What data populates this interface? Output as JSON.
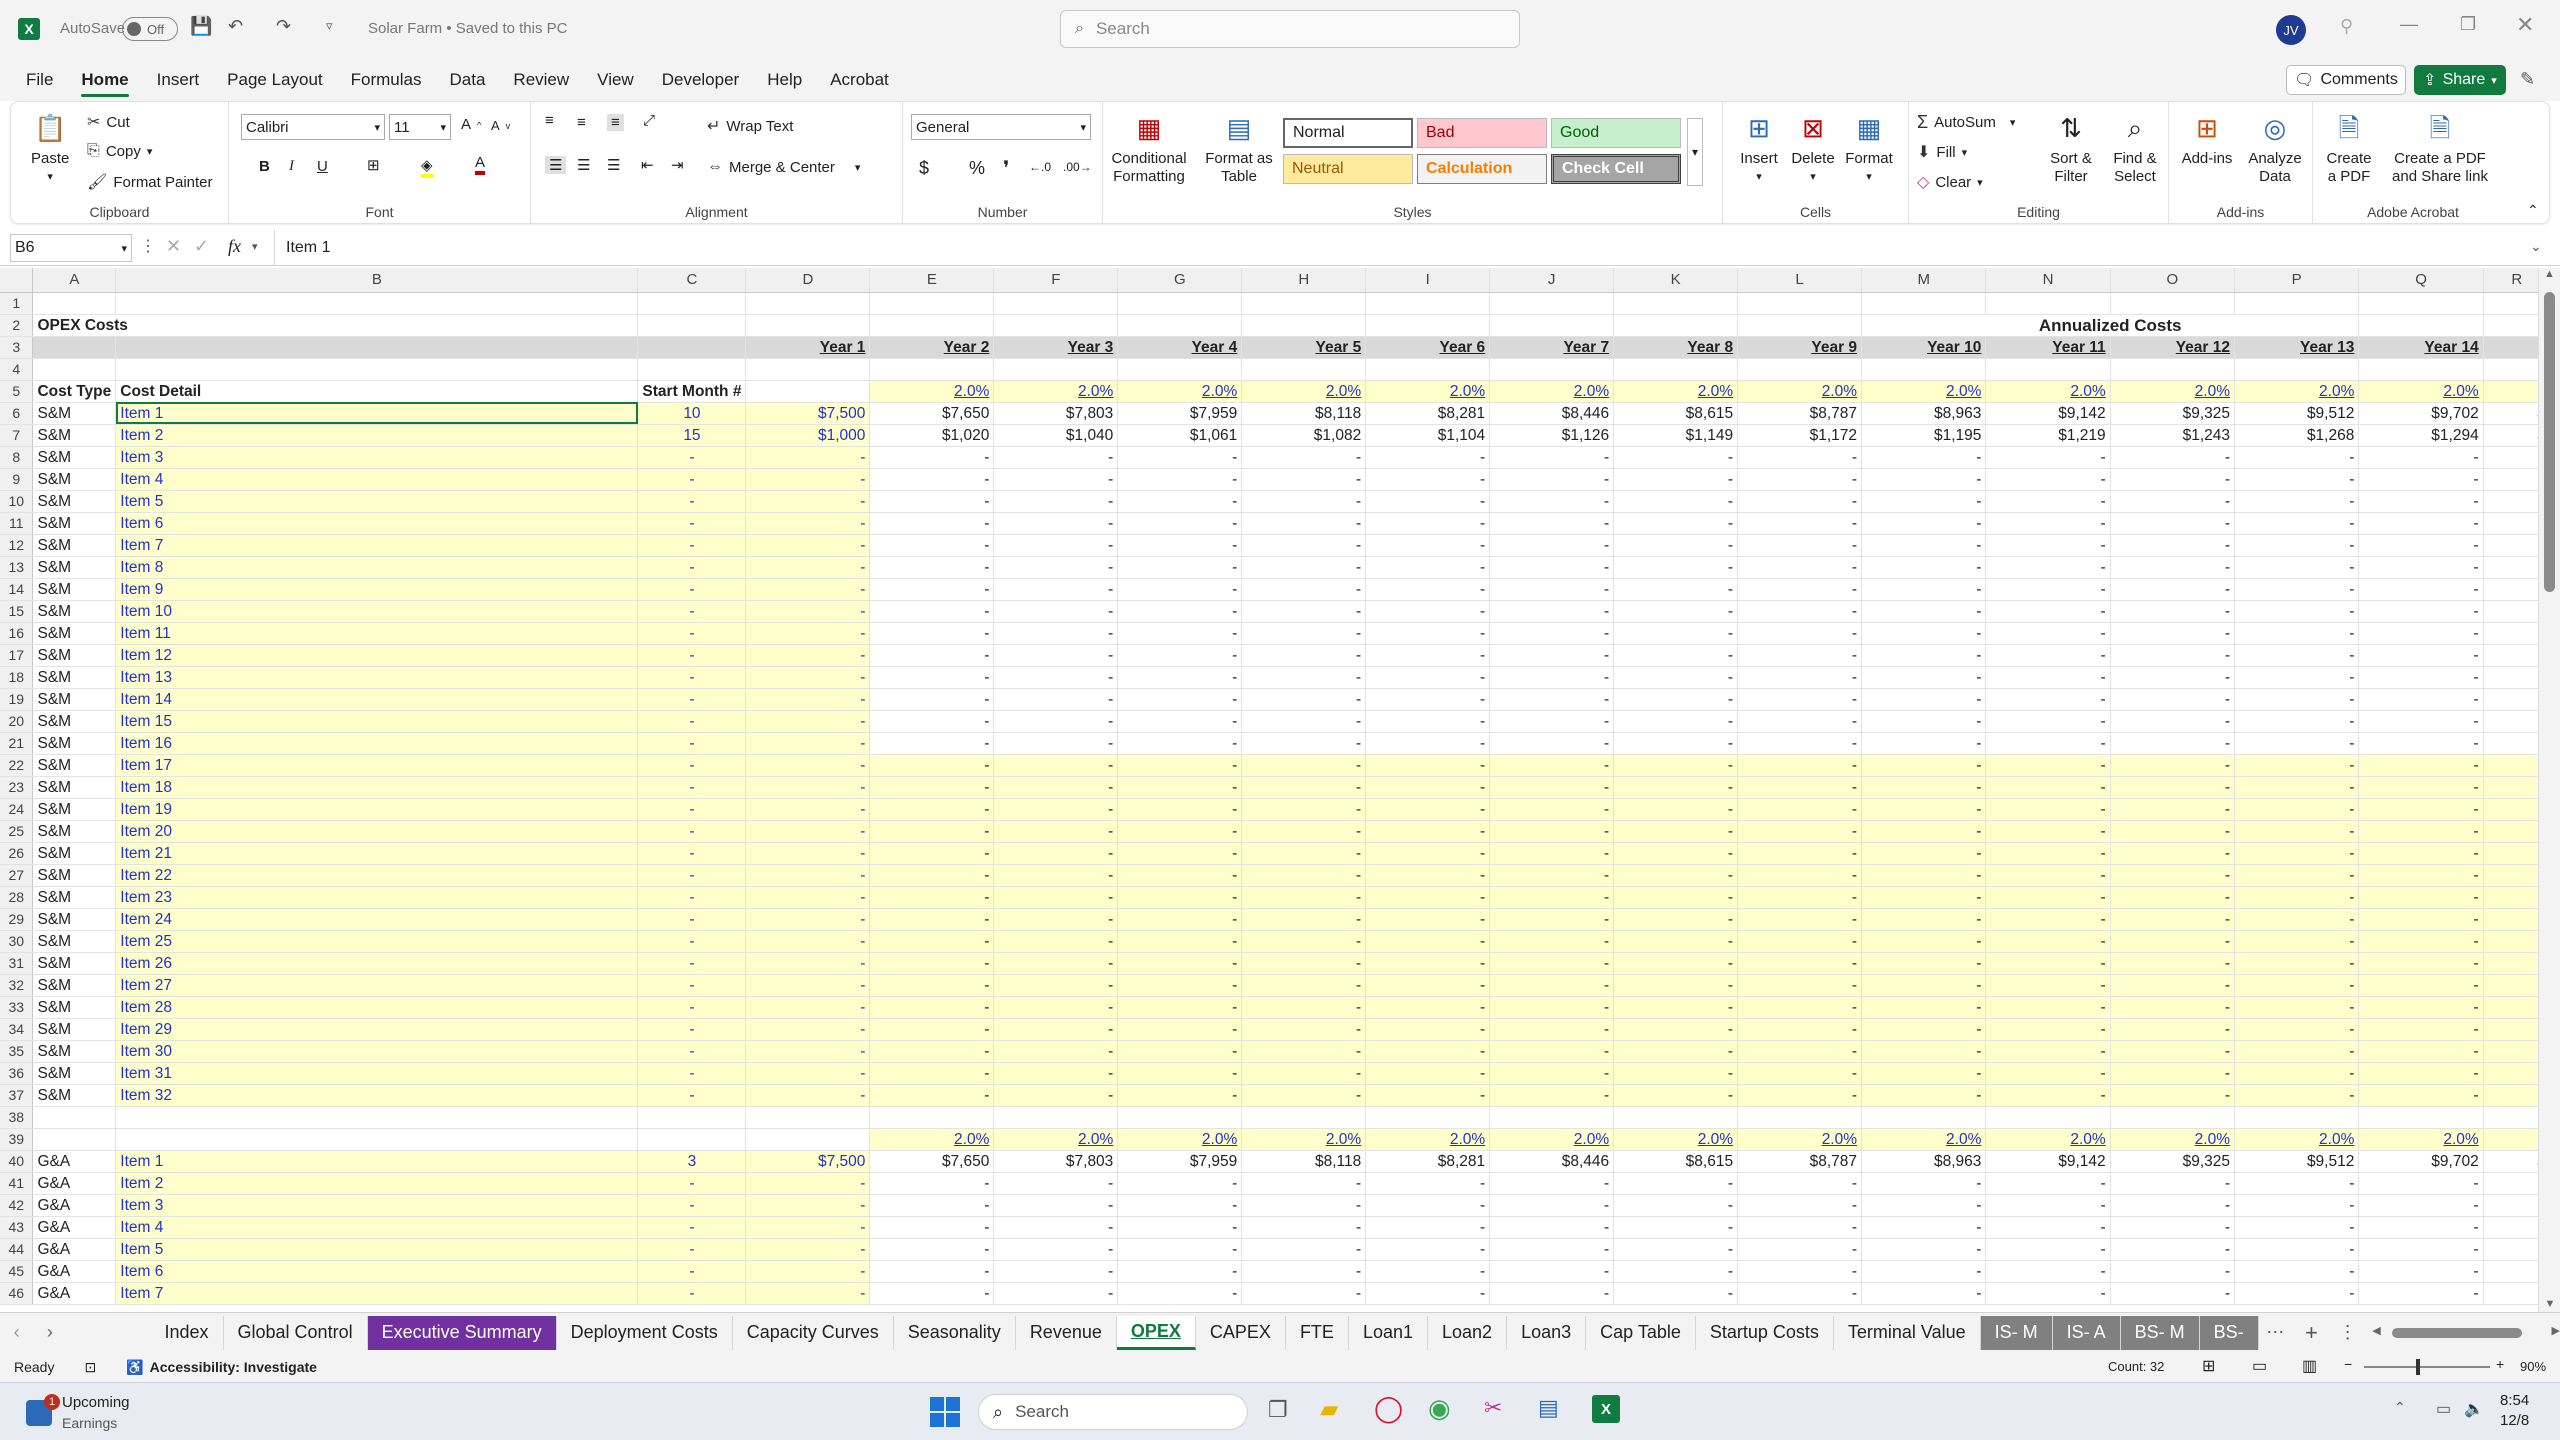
{
  "titlebar": {
    "autosave_label": "AutoSave",
    "autosave_state": "Off",
    "doc_title": "Solar Farm • Saved to this PC",
    "search_placeholder": "Search",
    "user_initials": "JV"
  },
  "ribbon_tabs": [
    "File",
    "Home",
    "Insert",
    "Page Layout",
    "Formulas",
    "Data",
    "Review",
    "View",
    "Developer",
    "Help",
    "Acrobat"
  ],
  "ribbon_right": {
    "comments": "Comments",
    "share": "Share"
  },
  "clipboard": {
    "paste": "Paste",
    "cut": "Cut",
    "copy": "Copy",
    "format_painter": "Format Painter",
    "label": "Clipboard"
  },
  "font": {
    "name": "Calibri",
    "size": "11",
    "label": "Font"
  },
  "alignment": {
    "wrap": "Wrap Text",
    "merge": "Merge & Center",
    "label": "Alignment"
  },
  "number": {
    "format": "General",
    "label": "Number"
  },
  "styles": {
    "cond": "Conditional Formatting",
    "fmt_table": "Format as Table",
    "normal": "Normal",
    "bad": "Bad",
    "good": "Good",
    "neutral": "Neutral",
    "calculation": "Calculation",
    "check": "Check Cell",
    "label": "Styles"
  },
  "cells": {
    "insert": "Insert",
    "delete": "Delete",
    "format": "Format",
    "label": "Cells"
  },
  "editing": {
    "autosum": "AutoSum",
    "fill": "Fill",
    "clear": "Clear",
    "sort": "Sort & Filter",
    "find": "Find & Select",
    "label": "Editing"
  },
  "addins": {
    "addins": "Add-ins",
    "analyze": "Analyze Data",
    "label": "Add-ins"
  },
  "acrobat": {
    "create_pdf": "Create a PDF",
    "share_pdf": "Create a PDF and Share link",
    "label": "Adobe Acrobat"
  },
  "formula_bar": {
    "name_box": "B6",
    "fx": "fx",
    "content": "Item 1"
  },
  "columns": [
    "A",
    "B",
    "C",
    "D",
    "E",
    "F",
    "G",
    "H",
    "I",
    "J",
    "K",
    "L",
    "M",
    "N",
    "O",
    "P",
    "Q",
    "R"
  ],
  "sheet": {
    "title": "OPEX Costs",
    "annual_title": "Annualized Costs",
    "years": [
      "Year 1",
      "Year 2",
      "Year 3",
      "Year 4",
      "Year 5",
      "Year 6",
      "Year 7",
      "Year 8",
      "Year 9",
      "Year 10",
      "Year 11",
      "Year 12",
      "Year 13",
      "Year 14"
    ],
    "headers": {
      "type": "Cost Type",
      "detail": "Cost Detail",
      "start": "Start Month #"
    },
    "growth": "2.0%",
    "row6": [
      "$7,650",
      "$7,803",
      "$7,959",
      "$8,118",
      "$8,281",
      "$8,446",
      "$8,615",
      "$8,787",
      "$8,963",
      "$9,142",
      "$9,325",
      "$9,512",
      "$9,702"
    ],
    "row7": [
      "$1,020",
      "$1,040",
      "$1,061",
      "$1,082",
      "$1,104",
      "$1,126",
      "$1,149",
      "$1,172",
      "$1,195",
      "$1,219",
      "$1,243",
      "$1,268",
      "$1,294"
    ]
  },
  "sheet_tabs": [
    "Index",
    "Global Control",
    "Executive Summary",
    "Deployment Costs",
    "Capacity Curves",
    "Seasonality",
    "Revenue",
    "OPEX",
    "CAPEX",
    "FTE",
    "Loan1",
    "Loan2",
    "Loan3",
    "Cap Table",
    "Startup Costs",
    "Terminal Value",
    "IS- M",
    "IS- A",
    "BS- M",
    "BS-"
  ],
  "status": {
    "ready": "Ready",
    "accessibility": "Accessibility: Investigate",
    "count": "Count: 32",
    "zoom": "90%"
  },
  "taskbar": {
    "widget_title": "Upcoming",
    "widget_sub": "Earnings",
    "badge": "1",
    "search": "Search",
    "time": "8:54",
    "date": "12/8"
  }
}
